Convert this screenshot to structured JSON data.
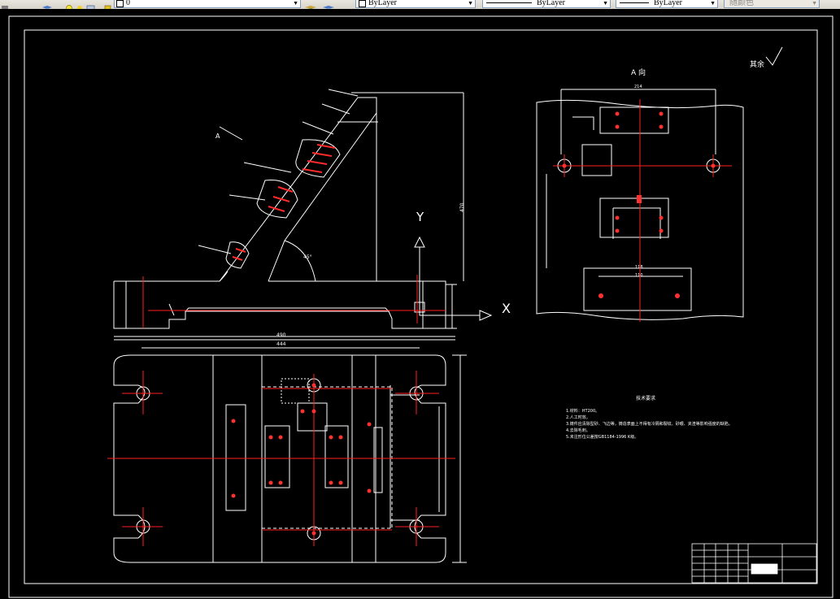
{
  "toolbar": {
    "layer_name": "0",
    "color_label": "ByLayer",
    "linetype_label": "ByLayer",
    "lineweight_label": "ByLayer",
    "plotstyle_label": "随颜色"
  },
  "drawing": {
    "view_a_label": "A 向",
    "view_a_arrow_label": "A",
    "roughness_note": "其余",
    "ucs_y": "Y",
    "ucs_x": "X",
    "dims": {
      "top_width": "214",
      "height_470": "470",
      "plan_width_490": "490",
      "plan_width_444": "444",
      "angle": "45°",
      "dim_118": "118",
      "dim_110": "110"
    },
    "tech_req": {
      "title": "技术要求",
      "lines": [
        "1.材料：HT200。",
        "2.人工时效。",
        "3.铸件应清除型砂、飞边等，铸造表面上不得有冷隔和裂纹、砂眼、夹渣等影响强度的缺陷。",
        "4.去除毛刺。",
        "5.未注形位公差按GB1184-1996 K级。"
      ]
    }
  },
  "colors": {
    "background": "#000000",
    "geometry": "#ffffff",
    "centerline": "#ff2020",
    "toolbar": "#dcd8d0"
  }
}
